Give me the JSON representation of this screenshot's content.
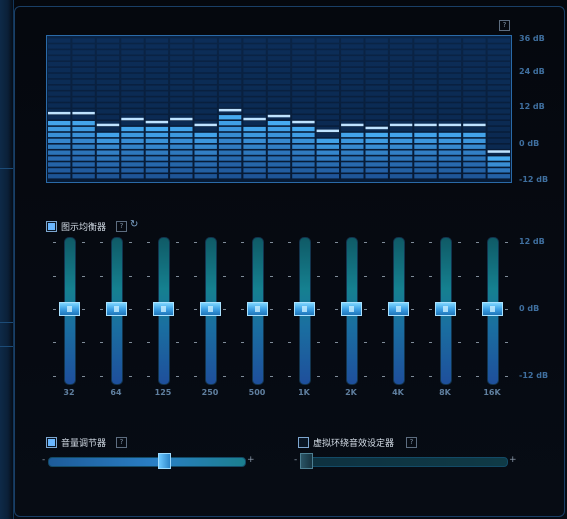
{
  "spectrum": {
    "scale_labels": [
      "36 dB",
      "24 dB",
      "12 dB",
      "0 dB",
      "-12 dB"
    ],
    "help_label": "?",
    "levels_db": [
      9,
      9,
      5,
      7,
      6,
      7,
      5,
      10,
      7,
      8,
      6,
      3,
      5,
      4,
      5,
      5,
      5,
      5,
      -4
    ]
  },
  "equalizer": {
    "title": "图示均衡器",
    "enabled": true,
    "help_label": "?",
    "reset_icon_glyph": "↻",
    "scale_labels": [
      "12 dB",
      "0 dB",
      "-12 dB"
    ],
    "bands": [
      {
        "label": "32",
        "gain_db": 0
      },
      {
        "label": "64",
        "gain_db": 0
      },
      {
        "label": "125",
        "gain_db": 0
      },
      {
        "label": "250",
        "gain_db": 0
      },
      {
        "label": "500",
        "gain_db": 0
      },
      {
        "label": "1K",
        "gain_db": 0
      },
      {
        "label": "2K",
        "gain_db": 0
      },
      {
        "label": "4K",
        "gain_db": 0
      },
      {
        "label": "8K",
        "gain_db": 0
      },
      {
        "label": "16K",
        "gain_db": 0
      }
    ]
  },
  "volume_leveler": {
    "title": "音量调节器",
    "enabled": true,
    "help_label": "?",
    "minus": "-",
    "plus": "+",
    "value_fraction": 0.6
  },
  "surround": {
    "title": "虚拟环绕音效设定器",
    "enabled": false,
    "help_label": "?",
    "minus": "-",
    "plus": "+",
    "value_fraction": 0.0
  },
  "colors": {
    "accent": "#4fb2ff",
    "track_cyan": "#1a8a9c",
    "track_blue": "#1f5fa8"
  }
}
